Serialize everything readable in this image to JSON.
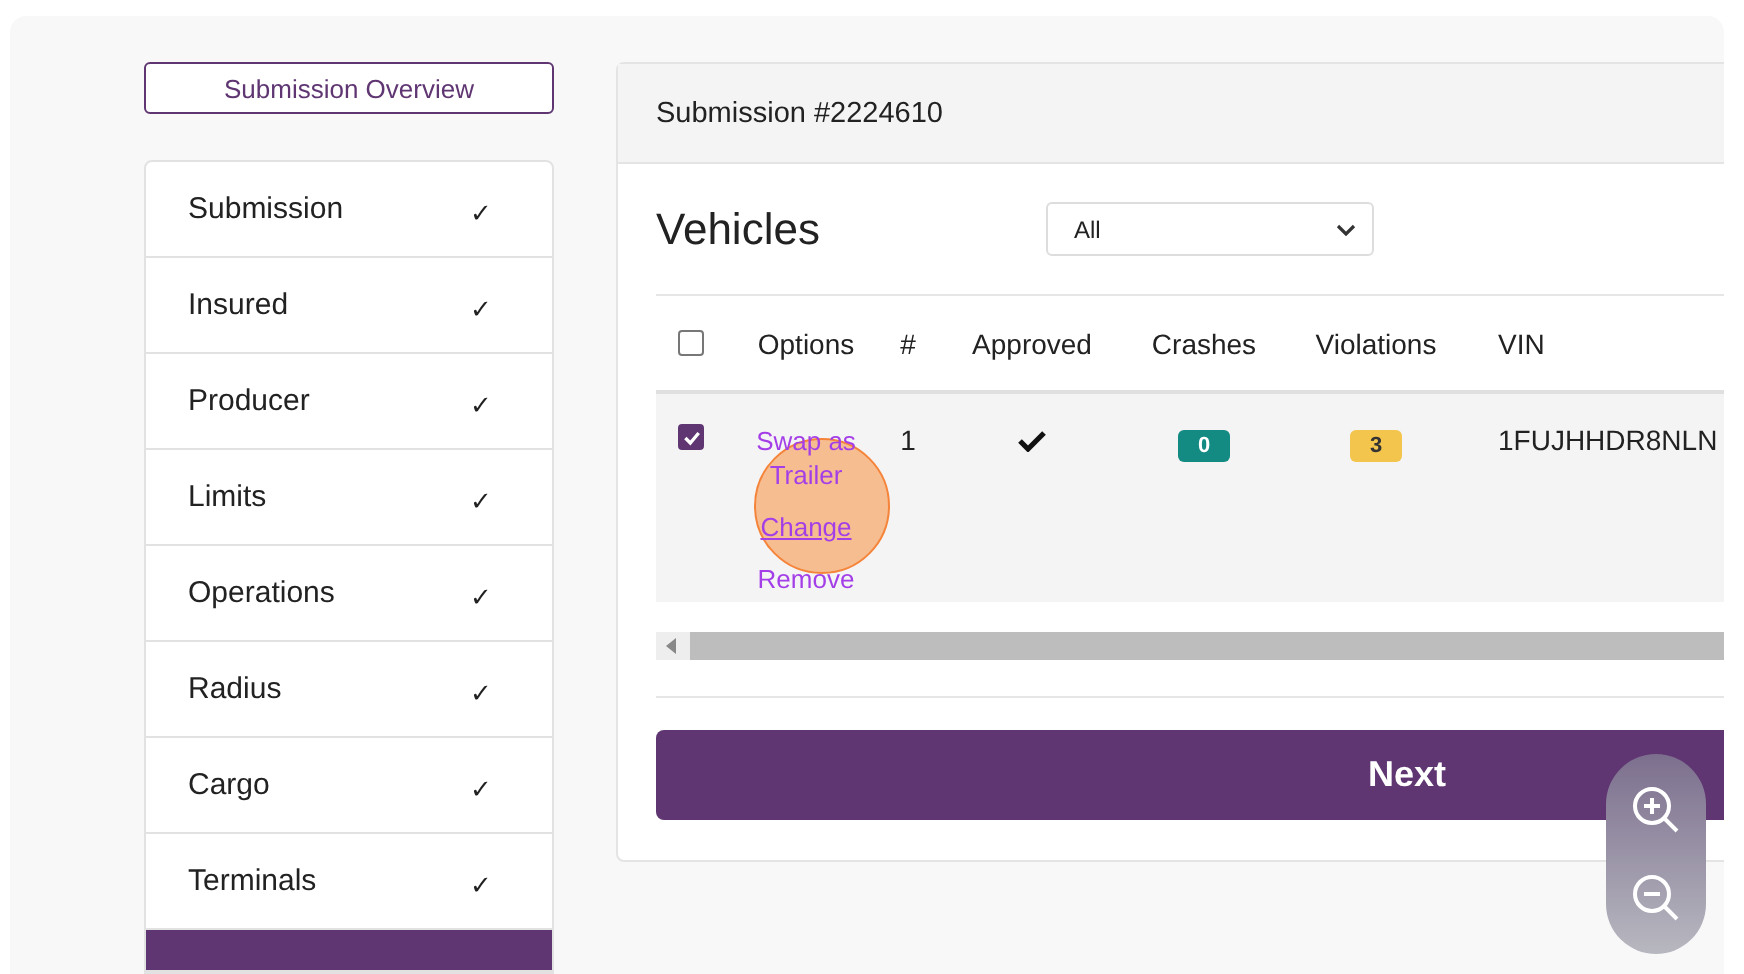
{
  "overview_button": "Submission Overview",
  "sidebar": {
    "items": [
      {
        "label": "Submission",
        "completed": true,
        "selected": false
      },
      {
        "label": "Insured",
        "completed": true,
        "selected": false
      },
      {
        "label": "Producer",
        "completed": true,
        "selected": false
      },
      {
        "label": "Limits",
        "completed": true,
        "selected": false
      },
      {
        "label": "Operations",
        "completed": true,
        "selected": false
      },
      {
        "label": "Radius",
        "completed": true,
        "selected": false
      },
      {
        "label": "Cargo",
        "completed": true,
        "selected": false
      },
      {
        "label": "Terminals",
        "completed": true,
        "selected": false
      },
      {
        "selected": true
      }
    ],
    "check_mark": "✓"
  },
  "panel": {
    "title": "Submission #2224610",
    "heading": "Vehicles",
    "filter": {
      "value": "All"
    },
    "table": {
      "select_all_checked": false,
      "columns": [
        "Options",
        "#",
        "Approved",
        "Crashes",
        "Violations",
        "VIN"
      ],
      "rows": [
        {
          "checked": true,
          "options": [
            "Swap as Trailer",
            "Change",
            "Remove"
          ],
          "number": "1",
          "approved": true,
          "crashes": "0",
          "violations": "3",
          "vin": "1FUJHHDR8NLN"
        }
      ]
    },
    "next_button": "Next"
  }
}
